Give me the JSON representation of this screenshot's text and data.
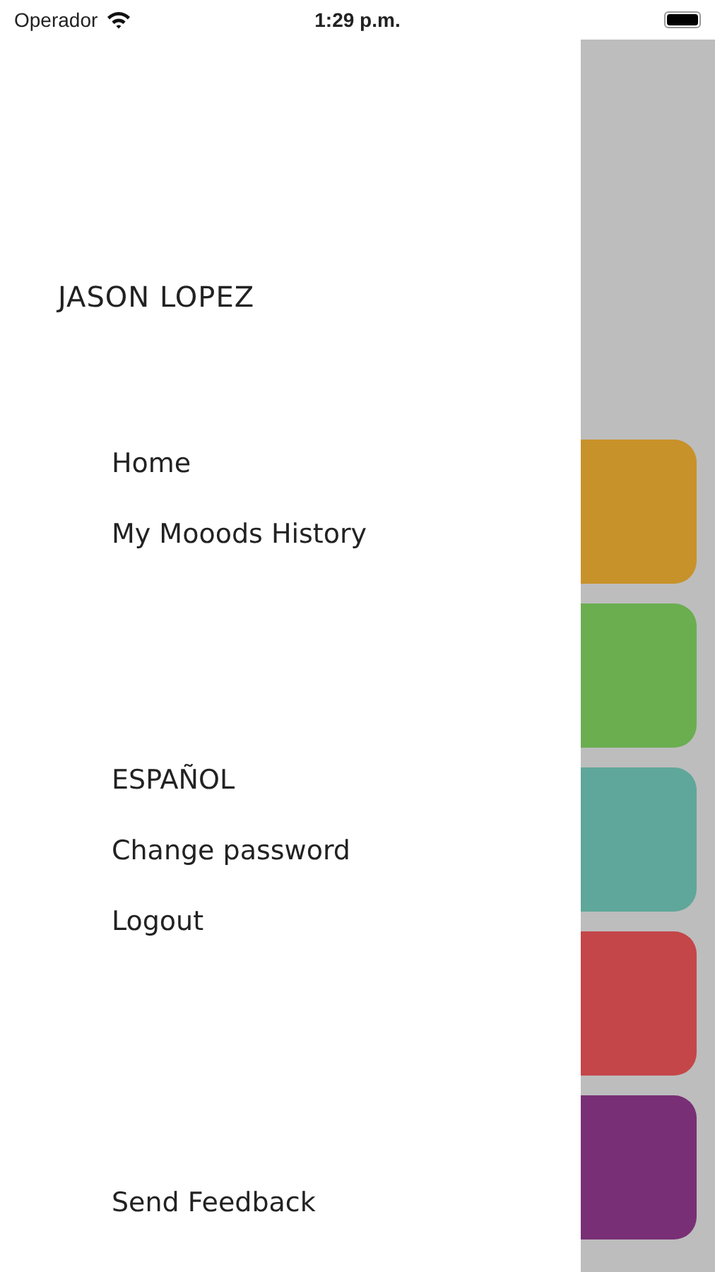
{
  "status_bar": {
    "carrier": "Operador",
    "time": "1:29 p.m."
  },
  "drawer": {
    "user_name": "JASON LOPEZ",
    "groups": [
      {
        "items": [
          "Home",
          "My Mooods History"
        ]
      },
      {
        "items": [
          "ESPAÑOL",
          "Change password",
          "Logout"
        ]
      },
      {
        "items": [
          "Send Feedback"
        ]
      }
    ]
  },
  "background_cards": [
    {
      "color": "#c8922a"
    },
    {
      "color": "#6aae50"
    },
    {
      "color": "#5fa79a"
    },
    {
      "color": "#c44649"
    },
    {
      "color": "#782f75"
    }
  ]
}
